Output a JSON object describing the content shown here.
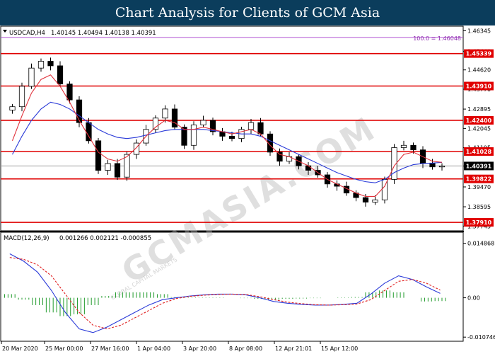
{
  "banner": {
    "title": "Chart Analysis for Clients of GCM Asia"
  },
  "watermark": {
    "text": "GCMASIA.COM",
    "subtext": "GLOBAL CAPITAL MARKETS"
  },
  "colors": {
    "level_line": "#e00000",
    "ma_fast": "#e0303a",
    "ma_slow": "#2a3ad8",
    "macd_line": "#2a3ad8",
    "signal_line": "#e02020",
    "histogram": "#1f9a2a",
    "fib_line": "#b050d0",
    "banner_bg": "#0b3d5c"
  },
  "chart_data": [
    {
      "type": "candlestick",
      "title": "USDCAD,H4",
      "ohlc_label": "1.40145 1.40494 1.40138 1.40391",
      "ylim": [
        1.376,
        1.4645
      ],
      "x_ticks": [
        "20 Mar 2020",
        "25 Mar 00:00",
        "27 Mar 16:00",
        "1 Apr 04:00",
        "3 Apr 20:00",
        "8 Apr 08:00",
        "12 Apr 21:01",
        "15 Apr 12:00"
      ],
      "y_ticks": [
        1.46345,
        1.4544,
        1.4462,
        1.4377,
        1.42895,
        1.42045,
        1.41195,
        1.40391,
        1.3947,
        1.38595,
        1.37745
      ],
      "fib_level": {
        "label": "100.0 = 1.46048",
        "value": 1.46048
      },
      "horizontal_levels": [
        1.45339,
        1.4391,
        1.424,
        1.41028,
        1.39822,
        1.3791
      ],
      "current_price": 1.40391,
      "closes": [
        1.43,
        1.439,
        1.447,
        1.45,
        1.448,
        1.44,
        1.433,
        1.423,
        1.415,
        1.402,
        1.405,
        1.399,
        1.409,
        1.414,
        1.42,
        1.425,
        1.429,
        1.421,
        1.413,
        1.422,
        1.424,
        1.419,
        1.417,
        1.416,
        1.42,
        1.423,
        1.418,
        1.41,
        1.406,
        1.408,
        1.404,
        1.402,
        1.4,
        1.396,
        1.395,
        1.392,
        1.39,
        1.388,
        1.389,
        1.398,
        1.412,
        1.413,
        1.411,
        1.405,
        1.4035,
        1.4039
      ],
      "ma_fast": [
        1.415,
        1.426,
        1.436,
        1.442,
        1.444,
        1.439,
        1.432,
        1.424,
        1.417,
        1.41,
        1.407,
        1.406,
        1.408,
        1.412,
        1.417,
        1.421,
        1.424,
        1.423,
        1.42,
        1.42,
        1.421,
        1.42,
        1.419,
        1.418,
        1.419,
        1.42,
        1.418,
        1.413,
        1.409,
        1.408,
        1.406,
        1.404,
        1.401,
        1.398,
        1.396,
        1.394,
        1.392,
        1.3905,
        1.3905,
        1.395,
        1.404,
        1.409,
        1.41,
        1.408,
        1.406,
        1.4055
      ],
      "ma_slow": [
        1.409,
        1.417,
        1.424,
        1.429,
        1.432,
        1.431,
        1.429,
        1.426,
        1.423,
        1.42,
        1.418,
        1.4165,
        1.416,
        1.4165,
        1.4175,
        1.4185,
        1.4195,
        1.42,
        1.42,
        1.42,
        1.42,
        1.4195,
        1.419,
        1.4185,
        1.418,
        1.418,
        1.417,
        1.415,
        1.413,
        1.411,
        1.409,
        1.407,
        1.405,
        1.403,
        1.401,
        1.3995,
        1.398,
        1.397,
        1.3965,
        1.398,
        1.401,
        1.403,
        1.4045,
        1.405,
        1.4052,
        1.4055
      ]
    },
    {
      "type": "macd",
      "title": "MACD(12,26,9)",
      "values_label": "0.001266 0.002121 -0.000855",
      "ylim": [
        -0.0111,
        0.0152
      ],
      "y_ticks": [
        0.014868,
        0.0,
        -0.010746
      ],
      "y_tick_labels": [
        "0.014868",
        "0.00",
        "-0.010746"
      ],
      "macd": [
        0.012,
        0.01,
        0.007,
        0.002,
        -0.004,
        -0.0085,
        -0.0095,
        -0.008,
        -0.006,
        -0.004,
        -0.002,
        -0.0005,
        0.0,
        0.0005,
        0.0008,
        0.001,
        0.001,
        0.0008,
        0.0,
        -0.001,
        -0.0015,
        -0.0018,
        -0.002,
        -0.002,
        -0.0018,
        -0.0015,
        0.001,
        0.004,
        0.006,
        0.005,
        0.003,
        0.0012
      ],
      "signal": [
        0.011,
        0.0105,
        0.009,
        0.006,
        0.001,
        -0.004,
        -0.0075,
        -0.0085,
        -0.0075,
        -0.0055,
        -0.0035,
        -0.0015,
        -0.0002,
        0.0004,
        0.0007,
        0.0009,
        0.001,
        0.0009,
        0.0003,
        -0.0005,
        -0.0012,
        -0.0016,
        -0.0019,
        -0.002,
        -0.0019,
        -0.0017,
        -0.0005,
        0.002,
        0.0045,
        0.005,
        0.004,
        0.0021
      ],
      "histogram": [
        0.001,
        -0.0005,
        -0.002,
        -0.004,
        -0.005,
        -0.0045,
        -0.002,
        0.0005,
        0.0015,
        0.0015,
        0.0015,
        0.001,
        0.0002,
        0.0001,
        0.0001,
        0.0001,
        0.0,
        -0.0001,
        -0.0003,
        -0.0005,
        -0.0003,
        -0.0002,
        -0.0001,
        0.0,
        0.0001,
        0.0002,
        0.0015,
        0.002,
        0.0015,
        0.0,
        -0.001,
        -0.0009
      ]
    }
  ]
}
